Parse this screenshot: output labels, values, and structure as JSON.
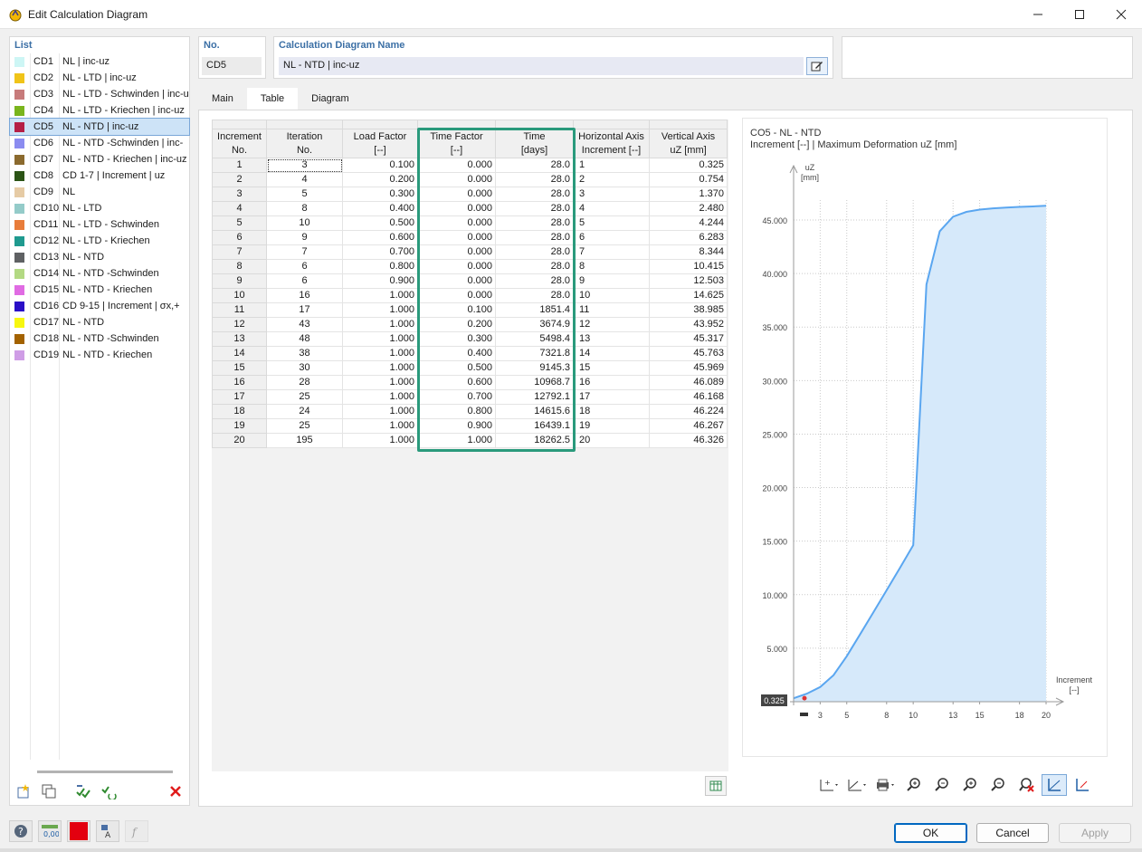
{
  "window": {
    "title": "Edit Calculation Diagram"
  },
  "list": {
    "header": "List",
    "items": [
      {
        "code": "CD1",
        "name": "NL | inc-uz",
        "color": "#cdf6f5",
        "selected": false
      },
      {
        "code": "CD2",
        "name": "NL - LTD | inc-uz",
        "color": "#f0c419",
        "selected": false
      },
      {
        "code": "CD3",
        "name": "NL - LTD - Schwinden | inc-u",
        "color": "#c77b7b",
        "selected": false
      },
      {
        "code": "CD4",
        "name": "NL - LTD - Kriechen | inc-uz",
        "color": "#7ab51d",
        "selected": false
      },
      {
        "code": "CD5",
        "name": "NL - NTD  | inc-uz",
        "color": "#b51f46",
        "selected": true
      },
      {
        "code": "CD6",
        "name": "NL - NTD -Schwinden  | inc-",
        "color": "#8b8cf0",
        "selected": false
      },
      {
        "code": "CD7",
        "name": "NL - NTD - Kriechen | inc-uz",
        "color": "#8b6a2e",
        "selected": false
      },
      {
        "code": "CD8",
        "name": "CD 1-7 | Increment | uz",
        "color": "#2c5416",
        "selected": false
      },
      {
        "code": "CD9",
        "name": "NL",
        "color": "#e6cba5",
        "selected": false
      },
      {
        "code": "CD10",
        "name": "NL - LTD",
        "color": "#94cbc9",
        "selected": false
      },
      {
        "code": "CD11",
        "name": "NL - LTD - Schwinden",
        "color": "#e87c3a",
        "selected": false
      },
      {
        "code": "CD12",
        "name": "NL - LTD - Kriechen",
        "color": "#1f9a8f",
        "selected": false
      },
      {
        "code": "CD13",
        "name": "NL - NTD",
        "color": "#5f6163",
        "selected": false
      },
      {
        "code": "CD14",
        "name": "NL - NTD -Schwinden",
        "color": "#b3d983",
        "selected": false
      },
      {
        "code": "CD15",
        "name": "NL - NTD - Kriechen",
        "color": "#e06be3",
        "selected": false
      },
      {
        "code": "CD16",
        "name": "CD 9-15 | Increment | σx,+",
        "color": "#2a0fc7",
        "selected": false
      },
      {
        "code": "CD17",
        "name": "NL - NTD",
        "color": "#f7f70f",
        "selected": false
      },
      {
        "code": "CD18",
        "name": "NL - NTD -Schwinden",
        "color": "#a36200",
        "selected": false
      },
      {
        "code": "CD19",
        "name": "NL - NTD - Kriechen",
        "color": "#cf9de6",
        "selected": false
      }
    ]
  },
  "header": {
    "no_label": "No.",
    "no_value": "CD5",
    "name_label": "Calculation Diagram Name",
    "name_value": "NL - NTD  | inc-uz"
  },
  "tabs": [
    "Main",
    "Table",
    "Diagram"
  ],
  "active_tab": "Table",
  "table": {
    "columns": [
      {
        "l1": "Increment",
        "l2": "No."
      },
      {
        "l1": "Iteration",
        "l2": "No."
      },
      {
        "l1": "Load Factor",
        "l2": "[--]"
      },
      {
        "l1": "Time Factor",
        "l2": "[--]"
      },
      {
        "l1": "Time",
        "l2": "[days]"
      },
      {
        "l1": "Horizontal Axis",
        "l2": "Increment [--]"
      },
      {
        "l1": "Vertical Axis",
        "l2": "uZ [mm]"
      }
    ],
    "rows": [
      [
        "1",
        "3",
        "0.100",
        "0.000",
        "28.0",
        "1",
        "0.325"
      ],
      [
        "2",
        "4",
        "0.200",
        "0.000",
        "28.0",
        "2",
        "0.754"
      ],
      [
        "3",
        "5",
        "0.300",
        "0.000",
        "28.0",
        "3",
        "1.370"
      ],
      [
        "4",
        "8",
        "0.400",
        "0.000",
        "28.0",
        "4",
        "2.480"
      ],
      [
        "5",
        "10",
        "0.500",
        "0.000",
        "28.0",
        "5",
        "4.244"
      ],
      [
        "6",
        "9",
        "0.600",
        "0.000",
        "28.0",
        "6",
        "6.283"
      ],
      [
        "7",
        "7",
        "0.700",
        "0.000",
        "28.0",
        "7",
        "8.344"
      ],
      [
        "8",
        "6",
        "0.800",
        "0.000",
        "28.0",
        "8",
        "10.415"
      ],
      [
        "9",
        "6",
        "0.900",
        "0.000",
        "28.0",
        "9",
        "12.503"
      ],
      [
        "10",
        "16",
        "1.000",
        "0.000",
        "28.0",
        "10",
        "14.625"
      ],
      [
        "11",
        "17",
        "1.000",
        "0.100",
        "1851.4",
        "11",
        "38.985"
      ],
      [
        "12",
        "43",
        "1.000",
        "0.200",
        "3674.9",
        "12",
        "43.952"
      ],
      [
        "13",
        "48",
        "1.000",
        "0.300",
        "5498.4",
        "13",
        "45.317"
      ],
      [
        "14",
        "38",
        "1.000",
        "0.400",
        "7321.8",
        "14",
        "45.763"
      ],
      [
        "15",
        "30",
        "1.000",
        "0.500",
        "9145.3",
        "15",
        "45.969"
      ],
      [
        "16",
        "28",
        "1.000",
        "0.600",
        "10968.7",
        "16",
        "46.089"
      ],
      [
        "17",
        "25",
        "1.000",
        "0.700",
        "12792.1",
        "17",
        "46.168"
      ],
      [
        "18",
        "24",
        "1.000",
        "0.800",
        "14615.6",
        "18",
        "46.224"
      ],
      [
        "19",
        "25",
        "1.000",
        "0.900",
        "16439.1",
        "19",
        "46.267"
      ],
      [
        "20",
        "195",
        "1.000",
        "1.000",
        "18262.5",
        "20",
        "46.326"
      ]
    ]
  },
  "chart_data": {
    "type": "area",
    "title": "CO5 - NL - NTD",
    "subtitle": "Increment [--] | Maximum Deformation uZ [mm]",
    "ylabel": "uZ",
    "yunit": "[mm]",
    "xlabel": "Increment",
    "xunit": "[--]",
    "x": [
      1,
      2,
      3,
      4,
      5,
      6,
      7,
      8,
      9,
      10,
      11,
      12,
      13,
      14,
      15,
      16,
      17,
      18,
      19,
      20
    ],
    "y": [
      0.325,
      0.754,
      1.37,
      2.48,
      4.244,
      6.283,
      8.344,
      10.415,
      12.503,
      14.625,
      38.985,
      43.952,
      45.317,
      45.763,
      45.969,
      46.089,
      46.168,
      46.224,
      46.267,
      46.326
    ],
    "xticks": [
      "3",
      "5",
      "8",
      "10",
      "13",
      "15",
      "18",
      "20"
    ],
    "yticks": [
      "5.000",
      "10.000",
      "15.000",
      "20.000",
      "25.000",
      "30.000",
      "35.000",
      "40.000",
      "45.000"
    ],
    "origin_label": "0.325",
    "line_color": "#5aa6f0",
    "fill_color": "#d6e9fa",
    "grid": true
  },
  "footer": {
    "ok": "OK",
    "cancel": "Cancel",
    "apply": "Apply"
  }
}
